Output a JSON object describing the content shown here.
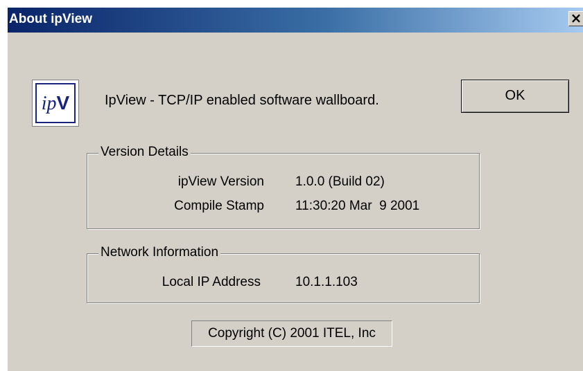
{
  "window": {
    "title": "About ipView",
    "close_glyph": "×"
  },
  "logo": {
    "text_ip": "ip",
    "text_v": "V",
    "icon": "ipview-logo-icon",
    "color": "#1a237e"
  },
  "description": "IpView - TCP/IP enabled software wallboard.",
  "ok_label": "OK",
  "version_details": {
    "title": "Version Details",
    "rows": [
      {
        "label": "ipView Version",
        "value": "1.0.0 (Build 02)"
      },
      {
        "label": "Compile Stamp",
        "value": "11:30:20 Mar  9 2001"
      }
    ]
  },
  "network_info": {
    "title": "Network Information",
    "rows": [
      {
        "label": "Local IP Address",
        "value": "10.1.1.103"
      }
    ]
  },
  "copyright": "Copyright (C) 2001 ITEL, Inc",
  "colors": {
    "titlebar_start": "#0a246a",
    "titlebar_end": "#a6caf0",
    "dialog_bg": "#d4d0c8"
  }
}
